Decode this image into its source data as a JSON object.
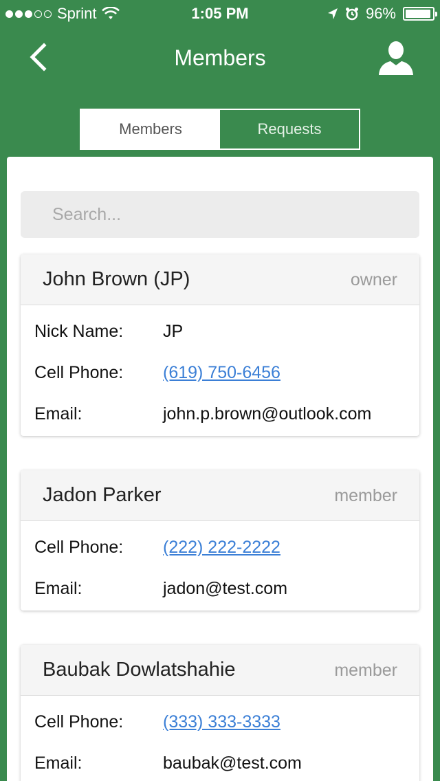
{
  "status_bar": {
    "carrier": "Sprint",
    "time": "1:05 PM",
    "battery": "96%",
    "battery_level": 0.96,
    "signal_bars": 3
  },
  "nav": {
    "title": "Members",
    "back_icon": "chevron-left-icon",
    "profile_icon": "user-icon"
  },
  "tabs": [
    {
      "label": "Members",
      "active": true
    },
    {
      "label": "Requests",
      "active": false
    }
  ],
  "search": {
    "placeholder": "Search..."
  },
  "members": [
    {
      "name": "John Brown (JP)",
      "role": "owner",
      "fields": [
        {
          "label": "Nick Name:",
          "value": "JP",
          "link": false
        },
        {
          "label": "Cell Phone:",
          "value": "(619) 750-6456",
          "link": true
        },
        {
          "label": "Email:",
          "value": "john.p.brown@outlook.com",
          "link": false
        }
      ]
    },
    {
      "name": "Jadon Parker",
      "role": "member",
      "fields": [
        {
          "label": "Cell Phone:",
          "value": "(222) 222-2222",
          "link": true
        },
        {
          "label": "Email:",
          "value": "jadon@test.com",
          "link": false
        }
      ]
    },
    {
      "name": "Baubak Dowlatshahie",
      "role": "member",
      "fields": [
        {
          "label": "Cell Phone:",
          "value": "(333) 333-3333",
          "link": true
        },
        {
          "label": "Email:",
          "value": "baubak@test.com",
          "link": false
        }
      ]
    }
  ],
  "colors": {
    "brand_green": "#3a8a4e",
    "link_blue": "#3b7fd6"
  }
}
